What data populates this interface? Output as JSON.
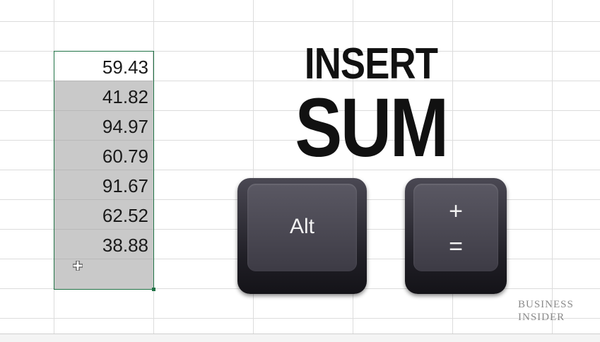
{
  "spreadsheet": {
    "cells": [
      "59.43",
      "41.82",
      "94.97",
      "60.79",
      "91.67",
      "62.52",
      "38.88",
      ""
    ]
  },
  "title": {
    "line1": "INSERT",
    "line2": "SUM"
  },
  "keys": {
    "alt": "Alt",
    "plus": "+",
    "equals": "="
  },
  "logo": {
    "line1": "BUSINESS",
    "line2": "INSIDER"
  },
  "colors": {
    "selection_border": "#217346",
    "selection_fill": "#c9c9c9",
    "key_body": "#2b2a31",
    "title_text": "#111111"
  },
  "icons": {
    "cursor": "cell-cursor-icon",
    "fill_handle": "fill-handle-icon"
  }
}
